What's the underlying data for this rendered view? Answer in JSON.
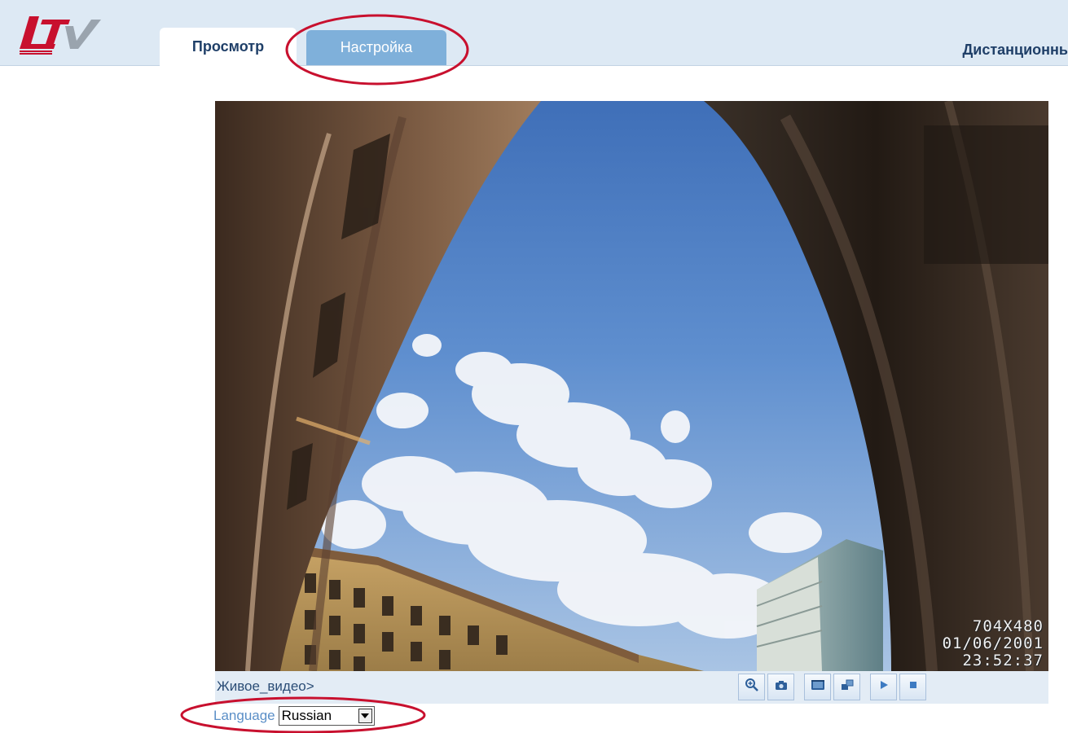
{
  "header": {
    "logo_text": "LTV",
    "tabs": [
      {
        "label": "Просмотр",
        "active": true
      },
      {
        "label": "Настройка",
        "active": false
      }
    ],
    "remote_link": "Дистанционнь"
  },
  "video": {
    "osd": {
      "resolution": "704X480",
      "date": "01/06/2001",
      "time": "23:52:37"
    }
  },
  "controlbar": {
    "breadcrumb": "Живое_видео>",
    "buttons": [
      {
        "icon": "zoom-in-icon"
      },
      {
        "icon": "camera-snapshot-icon"
      },
      {
        "icon": "record-icon"
      },
      {
        "icon": "fullscreen-icon"
      },
      {
        "icon": "play-icon"
      },
      {
        "icon": "stop-icon"
      }
    ]
  },
  "language": {
    "label": "Language",
    "selected": "Russian"
  },
  "colors": {
    "header_bg": "#dde9f4",
    "tab_active_text": "#1f3f68",
    "tab_inactive_bg": "#7fb0da",
    "annotation": "#c8102e"
  }
}
